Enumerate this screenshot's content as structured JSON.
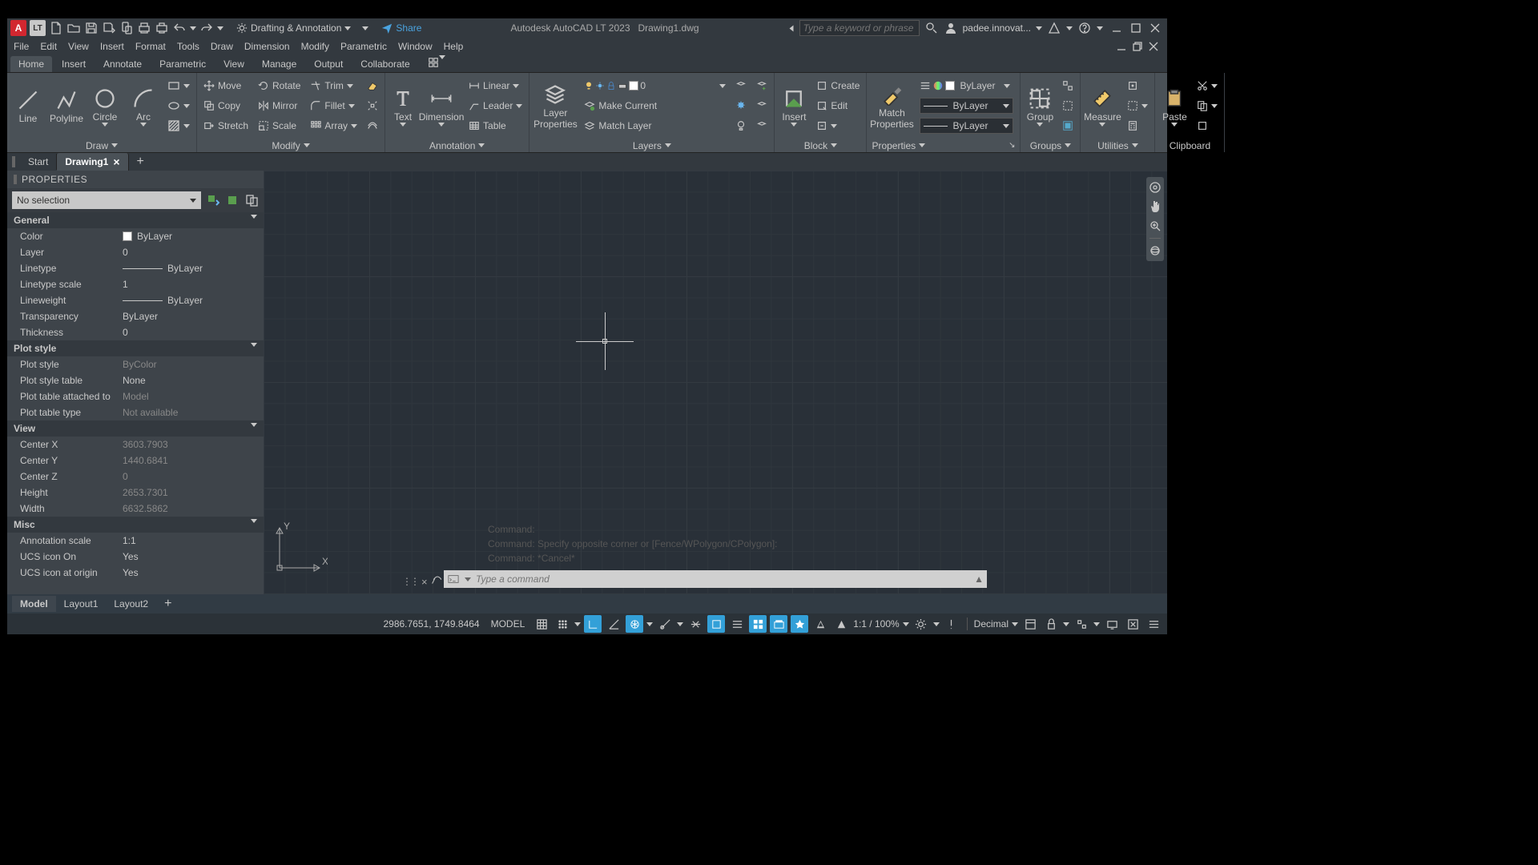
{
  "title": {
    "app": "Autodesk AutoCAD LT 2023",
    "doc": "Drawing1.dwg"
  },
  "qat": {
    "workspace": "Drafting & Annotation",
    "share": "Share"
  },
  "search": {
    "placeholder": "Type a keyword or phrase",
    "user": "padee.innovat..."
  },
  "menus": [
    "File",
    "Edit",
    "View",
    "Insert",
    "Format",
    "Tools",
    "Draw",
    "Dimension",
    "Modify",
    "Parametric",
    "Window",
    "Help"
  ],
  "rtabs": [
    "Home",
    "Insert",
    "Annotate",
    "Parametric",
    "View",
    "Manage",
    "Output",
    "Collaborate"
  ],
  "draw": {
    "line": "Line",
    "polyline": "Polyline",
    "circle": "Circle",
    "arc": "Arc",
    "label": "Draw"
  },
  "modify": {
    "move": "Move",
    "rotate": "Rotate",
    "trim": "Trim",
    "copy": "Copy",
    "mirror": "Mirror",
    "fillet": "Fillet",
    "stretch": "Stretch",
    "scale": "Scale",
    "array": "Array",
    "label": "Modify"
  },
  "annot": {
    "linear": "Linear",
    "leader": "Leader",
    "table": "Table",
    "text": "Text",
    "dim": "Dimension",
    "label": "Annotation"
  },
  "layers": {
    "prop": "Layer\nProperties",
    "layer": "0",
    "cur": "Make Current",
    "match": "Match Layer",
    "label": "Layers"
  },
  "block": {
    "insert": "Insert",
    "create": "Create",
    "edit": "Edit",
    "label": "Block"
  },
  "props": {
    "match": "Match\nProperties",
    "bylayer": "ByLayer",
    "label": "Properties"
  },
  "groups": {
    "group": "Group",
    "label": "Groups"
  },
  "util": {
    "measure": "Measure",
    "label": "Utilities"
  },
  "clip": {
    "paste": "Paste",
    "label": "Clipboard"
  },
  "ftabs": {
    "start": "Start",
    "drawing": "Drawing1"
  },
  "palette": {
    "title": "PROPERTIES",
    "sel": "No selection"
  },
  "pg": {
    "general": "General",
    "plot": "Plot style",
    "view": "View",
    "misc": "Misc"
  },
  "gen": {
    "color_l": "Color",
    "color_v": "ByLayer",
    "layer_l": "Layer",
    "layer_v": "0",
    "lt_l": "Linetype",
    "lt_v": "ByLayer",
    "lts_l": "Linetype scale",
    "lts_v": "1",
    "lw_l": "Lineweight",
    "lw_v": "ByLayer",
    "tr_l": "Transparency",
    "tr_v": "ByLayer",
    "th_l": "Thickness",
    "th_v": "0"
  },
  "plot": {
    "ps_l": "Plot style",
    "ps_v": "ByColor",
    "pst_l": "Plot style table",
    "pst_v": "None",
    "pta_l": "Plot table attached to",
    "pta_v": "Model",
    "ptt_l": "Plot table type",
    "ptt_v": "Not available"
  },
  "view": {
    "cx_l": "Center X",
    "cx_v": "3603.7903",
    "cy_l": "Center Y",
    "cy_v": "1440.6841",
    "cz_l": "Center Z",
    "cz_v": "0",
    "h_l": "Height",
    "h_v": "2653.7301",
    "w_l": "Width",
    "w_v": "6632.5862"
  },
  "misc": {
    "as_l": "Annotation scale",
    "as_v": "1:1",
    "uo_l": "UCS icon On",
    "uo_v": "Yes",
    "ua_l": "UCS icon at origin",
    "ua_v": "Yes"
  },
  "ucs": {
    "x": "X",
    "y": "Y"
  },
  "cmd": {
    "h1": "Command:",
    "h2": "Command: Specify opposite corner or [Fence/WPolygon/CPolygon]:",
    "h3": "Command: *Cancel*",
    "placeholder": "Type a command"
  },
  "layouts": {
    "model": "Model",
    "l1": "Layout1",
    "l2": "Layout2"
  },
  "status": {
    "coords": "2986.7651, 1749.8464",
    "model": "MODEL",
    "scale": "1:1 / 100%",
    "units": "Decimal"
  }
}
